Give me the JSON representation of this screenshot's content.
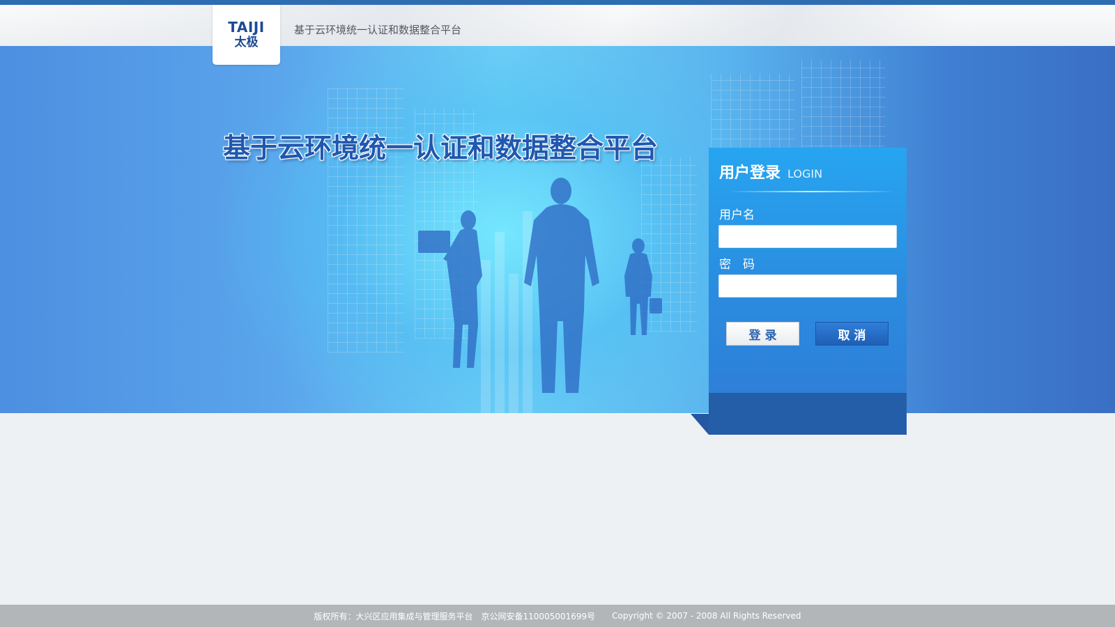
{
  "header": {
    "logo_en": "TAIJI",
    "logo_cn": "太极",
    "title": "基于云环境统一认证和数据整合平台"
  },
  "hero": {
    "title": "基于云环境统一认证和数据整合平台"
  },
  "login": {
    "heading_cn": "用户登录",
    "heading_en": "LOGIN",
    "username_label": "用户名",
    "username_value": "",
    "password_label": "密　码",
    "password_value": "",
    "login_button": "登录",
    "cancel_button": "取消"
  },
  "footer": {
    "rights": "版权所有：大兴区应用集成与管理服务平台",
    "icp": "京公网安备110005001699号",
    "copyright": "Copyright © 2007 - 2008  All Rights Reserved"
  },
  "colors": {
    "brand_blue": "#1d4a96",
    "accent": "#2f6db3",
    "panel": "#2a8de0",
    "footer": "#b3b6b9"
  }
}
